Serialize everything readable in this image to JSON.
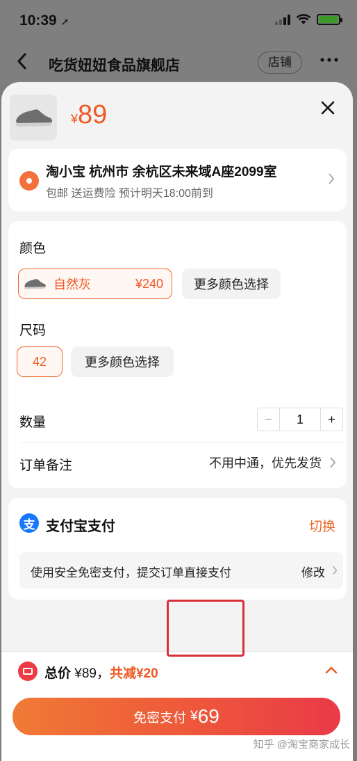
{
  "status": {
    "time": "10:39",
    "arrow": "➚"
  },
  "nav": {
    "title": "吃货妞妞食品旗舰店",
    "store_label": "店铺"
  },
  "product": {
    "currency": "¥",
    "price": "89"
  },
  "address": {
    "line1": "淘小宝  杭州市 余杭区未来域A座2099室",
    "line2": "包邮  送运费险  预计明天18:00前到"
  },
  "spec": {
    "color_label": "颜色",
    "color_option": {
      "name": "自然灰",
      "price": "¥240"
    },
    "more_colors": "更多颜色选择",
    "size_label": "尺码",
    "size_option": "42",
    "more_sizes": "更多颜色选择",
    "quantity_label": "数量",
    "quantity": {
      "minus": "−",
      "value": "1",
      "plus": "+"
    },
    "note_label": "订单备注",
    "note_value": "不用中通，优先发货"
  },
  "payment": {
    "icon_text": "支",
    "method": "支付宝支付",
    "switch": "切换",
    "desc": "使用安全免密支付，提交订单直接支付",
    "edit": "修改"
  },
  "summary": {
    "total_label": "总价",
    "total_amount": "¥89，",
    "discount": "共减¥20"
  },
  "pay_button": {
    "text": "免密支付",
    "currency": "¥",
    "amount": "69"
  },
  "watermark": "知乎 @淘宝商家成长",
  "colors": {
    "accent": "#ee5a24",
    "alipay": "#1677ff",
    "button_end": "#e93a48"
  },
  "icons": [
    "back-arrow-icon",
    "more-icon",
    "close-icon",
    "location-pin-icon",
    "chevron-right-icon",
    "alipay-icon",
    "coupon-icon",
    "chevron-up-icon",
    "shoe-icon"
  ]
}
